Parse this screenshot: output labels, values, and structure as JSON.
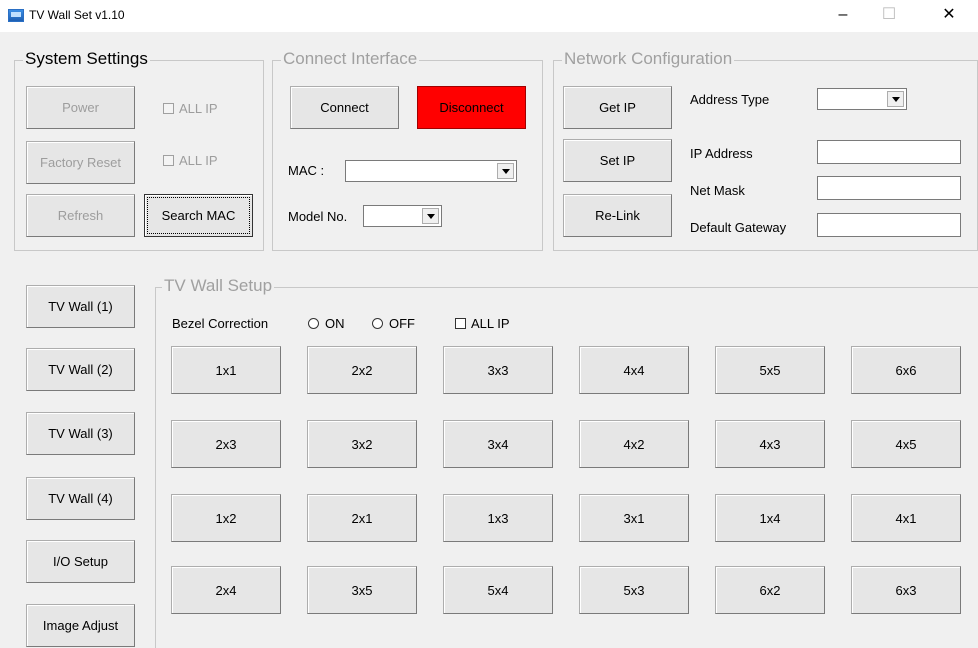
{
  "window": {
    "title": "TV Wall Set v1.10",
    "minimize": "–",
    "maximize": "☐",
    "close": "✕"
  },
  "system_settings": {
    "title": "System Settings",
    "power": "Power",
    "factory_reset": "Factory Reset",
    "refresh": "Refresh",
    "search_mac": "Search MAC",
    "all_ip": "ALL IP"
  },
  "connect_interface": {
    "title": "Connect Interface",
    "connect": "Connect",
    "disconnect": "Disconnect",
    "mac_label": "MAC :",
    "model_label": "Model No."
  },
  "network": {
    "title": "Network Configuration",
    "get_ip": "Get IP",
    "set_ip": "Set IP",
    "relink": "Re-Link",
    "address_type": "Address Type",
    "ip_address": "IP Address",
    "net_mask": "Net Mask",
    "default_gateway": "Default Gateway"
  },
  "sidebar": [
    "TV Wall (1)",
    "TV Wall (2)",
    "TV Wall (3)",
    "TV Wall (4)",
    "I/O Setup",
    "Image Adjust"
  ],
  "tv_wall_setup": {
    "title": "TV Wall Setup",
    "bezel_label": "Bezel Correction",
    "on": "ON",
    "off": "OFF",
    "all_ip": "ALL IP",
    "layouts": [
      [
        "1x1",
        "2x2",
        "3x3",
        "4x4",
        "5x5",
        "6x6"
      ],
      [
        "2x3",
        "3x2",
        "3x4",
        "4x2",
        "4x3",
        "4x5"
      ],
      [
        "1x2",
        "2x1",
        "1x3",
        "3x1",
        "1x4",
        "4x1"
      ],
      [
        "2x4",
        "3x5",
        "5x4",
        "5x3",
        "6x2",
        "6x3"
      ]
    ]
  },
  "colors": {
    "disconnect_bg": "#ff0000",
    "window_bg": "#f0f0f0"
  }
}
